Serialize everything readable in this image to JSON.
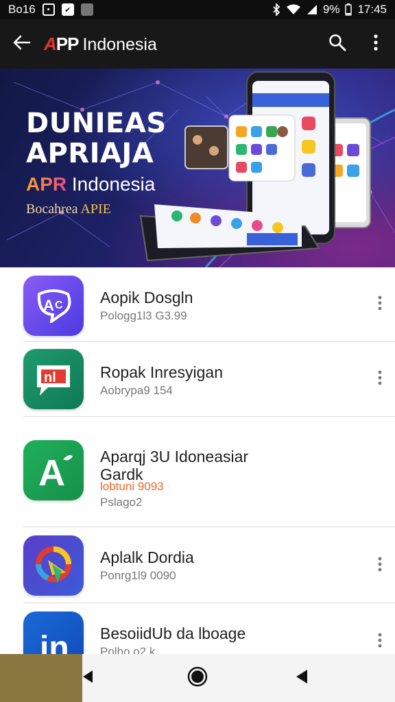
{
  "status_bar": {
    "left_text": "Bo16",
    "battery": "9%",
    "time": "17:45"
  },
  "app_bar": {
    "logo_letter": "A",
    "logo_rest": "PP",
    "title_rest": "Indonesia",
    "icons": [
      "arrow-back-icon",
      "search-icon",
      "more-vert-icon"
    ]
  },
  "banner": {
    "line1": "DUNIEAS",
    "line2": "APRIAJA",
    "brand_highlight": "APR",
    "brand_rest": "Indonesia",
    "sub_text": "Bocahrea",
    "sub_highlight": "APIE"
  },
  "apps": [
    {
      "name": "Aopik Dosgln",
      "meta": "Pologg1l3   G3.99",
      "meta_accent": ""
    },
    {
      "name": "Ropak Inresyigan",
      "meta": "Aobrypa9   154",
      "meta_accent": ""
    },
    {
      "name": "Aparqj 3U Idoneasiar",
      "name2": "Gardk",
      "meta_accent": "lobtuni 9093",
      "meta": "Pslago2"
    },
    {
      "name": "Aplalk Dordia",
      "meta": "Ponrg1l9   0090",
      "meta_accent": ""
    },
    {
      "name": "BesoiidUb da lboage",
      "meta": "Polho o2 k",
      "meta_accent": ""
    }
  ],
  "colors": {
    "status_bg": "#0e0e0e",
    "app_bar_bg": "#181818",
    "logo_accent": "#e8332f",
    "meta_accent": "#e66a2c"
  }
}
